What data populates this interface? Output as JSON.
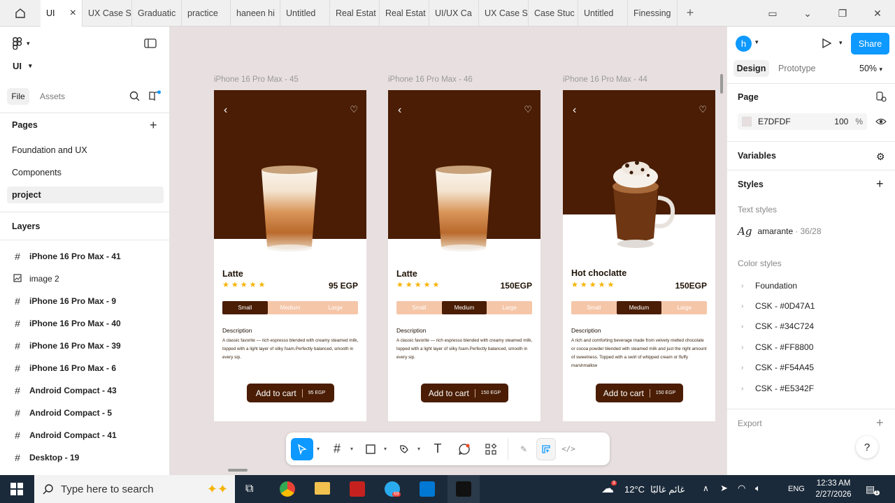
{
  "tabs": [
    {
      "label": "UI",
      "active": true
    },
    {
      "label": "UX Case S"
    },
    {
      "label": "Graduatic"
    },
    {
      "label": "practice"
    },
    {
      "label": "haneen hi"
    },
    {
      "label": "Untitled"
    },
    {
      "label": "Real Estat"
    },
    {
      "label": "Real Estat"
    },
    {
      "label": "UI/UX Ca"
    },
    {
      "label": "UX Case S"
    },
    {
      "label": "Case Stuc"
    },
    {
      "label": "Untitled"
    },
    {
      "label": "Finessing"
    }
  ],
  "left": {
    "file_name": "UI",
    "tab_file": "File",
    "tab_assets": "Assets",
    "pages_title": "Pages",
    "pages": [
      "Foundation and UX",
      "Components",
      "project"
    ],
    "layers_title": "Layers",
    "layers": [
      {
        "label": "iPhone 16 Pro Max - 41",
        "icon": "frame-icon"
      },
      {
        "label": "image 2",
        "icon": "image-icon"
      },
      {
        "label": "iPhone 16 Pro Max - 9",
        "icon": "frame-icon"
      },
      {
        "label": "iPhone 16 Pro Max - 40",
        "icon": "frame-icon"
      },
      {
        "label": "iPhone 16 Pro Max - 39",
        "icon": "frame-icon"
      },
      {
        "label": "iPhone 16 Pro Max - 6",
        "icon": "frame-icon"
      },
      {
        "label": "Android Compact - 43",
        "icon": "frame-icon"
      },
      {
        "label": "Android Compact - 5",
        "icon": "frame-icon"
      },
      {
        "label": "Android Compact - 41",
        "icon": "frame-icon"
      },
      {
        "label": "Desktop - 19",
        "icon": "frame-icon"
      }
    ]
  },
  "frames": [
    {
      "label": "iPhone 16 Pro Max - 45",
      "title": "Latte",
      "price": "95 EGP",
      "sizes": [
        "Small",
        "Medium",
        "Large"
      ],
      "selected_size": 0,
      "desc_title": "Description",
      "desc": "A classic favorite — rich espresso blended with creamy steamed milk, topped with a light layer of silky foam.Perfectly balanced, smooth in every sip.",
      "cart_label": "Add to cart",
      "cart_price": "95 EGP",
      "drink": "latte"
    },
    {
      "label": "iPhone 16 Pro Max - 46",
      "title": "Latte",
      "price": "150EGP",
      "sizes": [
        "Small",
        "Medium",
        "Large"
      ],
      "selected_size": 1,
      "desc_title": "Description",
      "desc": "A classic favorite — rich espresso blended with creamy steamed milk, topped with a light layer of silky foam.Perfectly balanced, smooth in every sip.",
      "cart_label": "Add to cart",
      "cart_price": "150 EGP",
      "drink": "latte"
    },
    {
      "label": "iPhone 16 Pro Max - 44",
      "title": "Hot choclatte",
      "price": "150EGP",
      "sizes": [
        "Small",
        "Medium",
        "Large"
      ],
      "selected_size": 1,
      "desc_title": "Description",
      "desc": "A rich and comforting beverage made from velvety melted chocolate or cocoa powder blended with steamed milk and just the right amount of sweetness. Topped with a swirl of whipped cream or fluffy marshmallow",
      "cart_label": "Add to cart",
      "cart_price": "150 EGP",
      "drink": "chocolate"
    }
  ],
  "right": {
    "avatar": "h",
    "share": "Share",
    "tab_design": "Design",
    "tab_prototype": "Prototype",
    "zoom": "50%",
    "page_title": "Page",
    "page_color": "E7DFDF",
    "page_opacity": "100",
    "percent": "%",
    "variables": "Variables",
    "styles": "Styles",
    "text_styles": "Text styles",
    "text_style_glyph": "Ag",
    "text_style_name": "amarante",
    "text_style_size": "· 36/28",
    "color_styles": "Color styles",
    "color_list": [
      "Foundation",
      "CSK - #0D47A1",
      "CSK - #34C724",
      "CSK - #FF8800",
      "CSK - #F54A45",
      "CSK - #E5342F"
    ],
    "export": "Export",
    "help": "?"
  },
  "taskbar": {
    "search_placeholder": "Type here to search",
    "weather_temp": "12°C",
    "weather_desc": "غائم غالبًا",
    "lang": "ENG",
    "time": "12:33 AM",
    "date": "2/27/2026",
    "telegram_badge": "69",
    "notif_badge": "1",
    "weather_badge": "3"
  },
  "colors": {
    "coffee_dark": "#4a1d04",
    "size_peach": "#f5c6a8",
    "figma_blue": "#0d99ff",
    "canvas_bg": "#e8dfe0"
  }
}
